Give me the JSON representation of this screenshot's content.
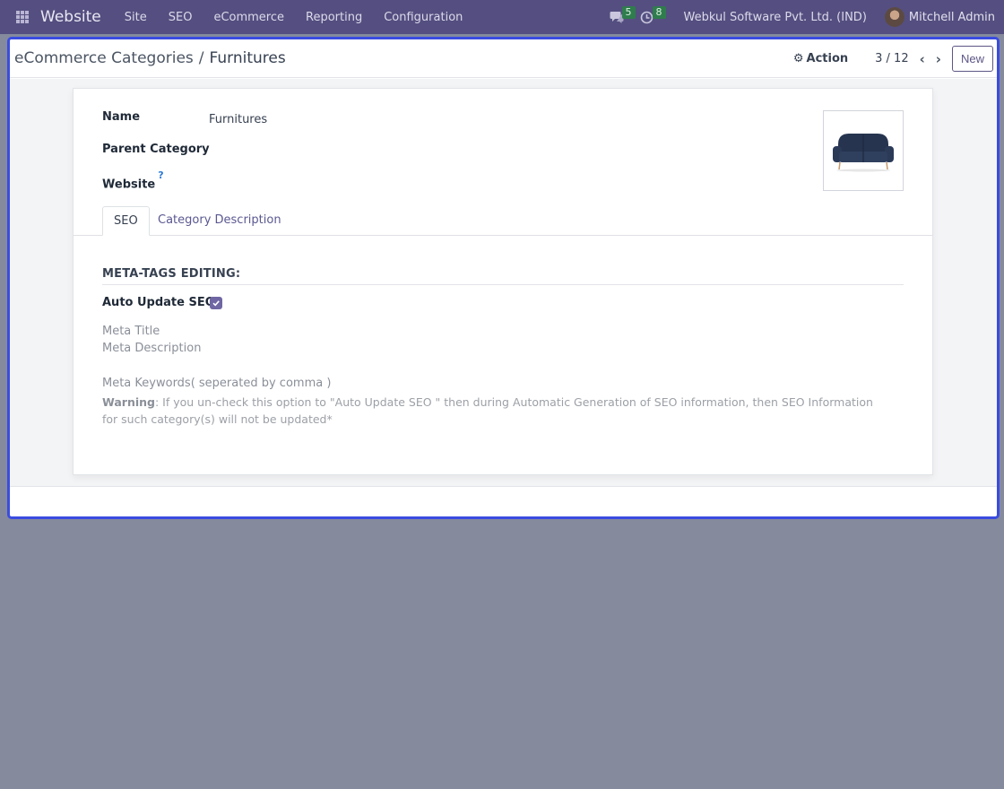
{
  "navbar": {
    "brand": "Website",
    "menu": [
      "Site",
      "SEO",
      "eCommerce",
      "Reporting",
      "Configuration"
    ],
    "messages_count": "5",
    "activities_count": "8",
    "company": "Webkul Software Pvt. Ltd. (IND)",
    "user": "Mitchell Admin"
  },
  "control_panel": {
    "breadcrumb_parent": "eCommerce Categories",
    "breadcrumb_separator": "/",
    "breadcrumb_current": "Furnitures",
    "action_label": "Action",
    "pager": "3 / 12",
    "new_label": "New"
  },
  "form": {
    "name_label": "Name",
    "name_value": "Furnitures",
    "parent_label": "Parent Category",
    "website_label": "Website",
    "website_help": "?"
  },
  "tabs": [
    {
      "label": "SEO",
      "active": true
    },
    {
      "label": "Category Description",
      "active": false
    }
  ],
  "seo": {
    "section_title": "META-TAGS EDITING:",
    "auto_update_label": "Auto Update SEO",
    "auto_update_checked": true,
    "meta_title_label": "Meta Title",
    "meta_description_label": "Meta Description",
    "meta_keywords_label": "Meta Keywords( seperated by comma )",
    "warning_label": "Warning",
    "warning_text": ": If you un-check this option to \"Auto Update SEO \" then during Automatic Generation of SEO information, then SEO Information for such category(s) will not be updated*"
  },
  "colors": {
    "navbar": "#544f80",
    "accent": "#6f66a3",
    "frame_border": "#3a4ce0",
    "badge": "#2f7d4d"
  }
}
